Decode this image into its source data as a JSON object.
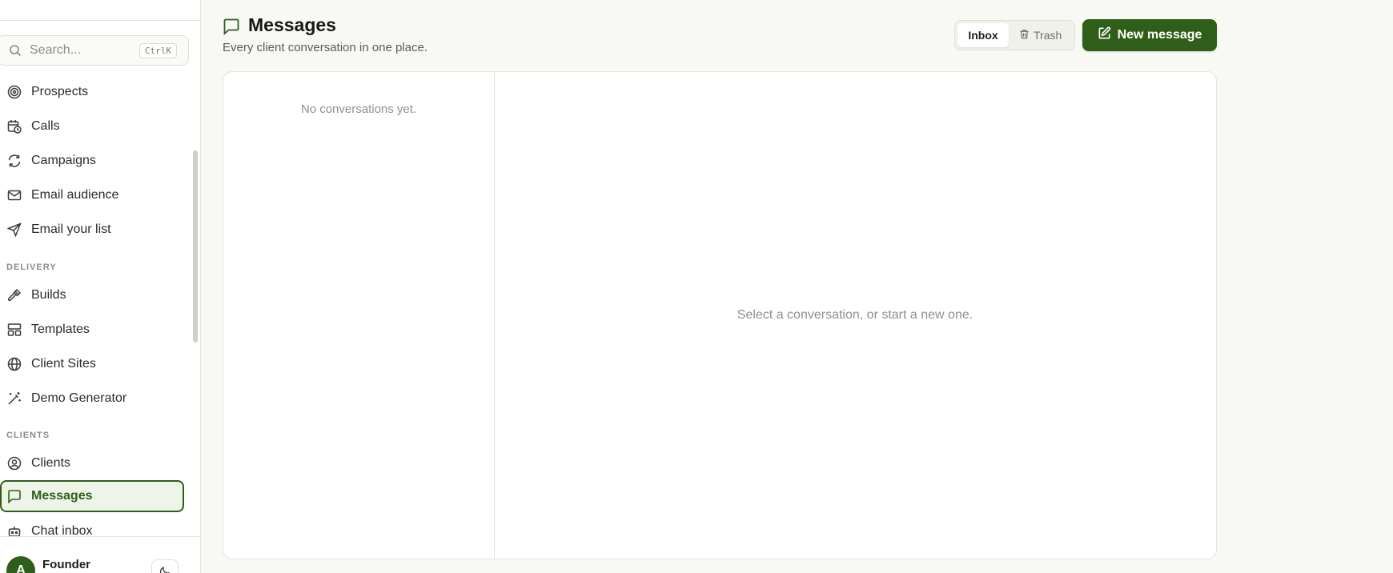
{
  "sidebar": {
    "search": {
      "placeholder": "Search...",
      "shortcut": "CtrlK"
    },
    "items": [
      {
        "label": "Prospects",
        "icon": "target-icon"
      },
      {
        "label": "Calls",
        "icon": "calendar-clock-icon"
      },
      {
        "label": "Campaigns",
        "icon": "refresh-icon"
      },
      {
        "label": "Email audience",
        "icon": "mail-icon"
      },
      {
        "label": "Email your list",
        "icon": "send-icon"
      }
    ],
    "sections": [
      {
        "label": "DELIVERY",
        "items": [
          {
            "label": "Builds",
            "icon": "hammer-icon"
          },
          {
            "label": "Templates",
            "icon": "layout-icon"
          },
          {
            "label": "Client Sites",
            "icon": "globe-icon"
          },
          {
            "label": "Demo Generator",
            "icon": "magic-wand-icon"
          }
        ]
      },
      {
        "label": "CLIENTS",
        "items": [
          {
            "label": "Clients",
            "icon": "user-circle-icon"
          },
          {
            "label": "Messages",
            "icon": "message-square-icon",
            "active": true
          },
          {
            "label": "Chat inbox",
            "icon": "bot-icon"
          }
        ]
      }
    ],
    "footer": {
      "avatar_initial": "A",
      "name": "Founder"
    }
  },
  "header": {
    "title": "Messages",
    "subtitle": "Every client conversation in one place.",
    "tabs": {
      "inbox": "Inbox",
      "trash": "Trash"
    },
    "new_button": "New message"
  },
  "main": {
    "empty_list": "No conversations yet.",
    "empty_detail": "Select a conversation, or start a new one."
  },
  "colors": {
    "accent": "#2f5e1a",
    "accent_bg": "#eef5e8",
    "background": "#f8f8f4"
  }
}
